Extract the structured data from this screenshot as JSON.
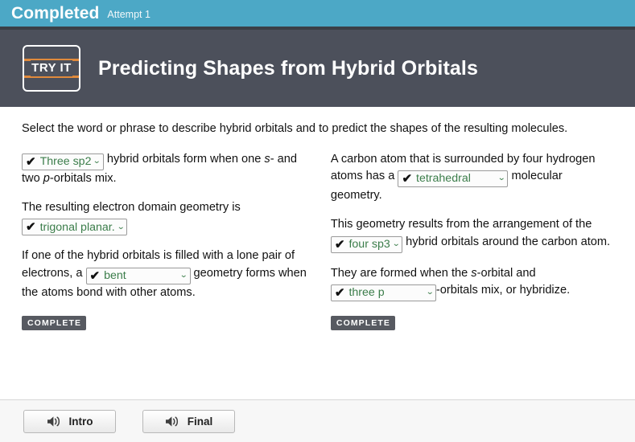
{
  "status_bar": {
    "state_label": "Completed",
    "attempt_label": "Attempt 1",
    "background_color": "#4ca8c6"
  },
  "header": {
    "logo_text": "TRY IT",
    "title": "Predicting Shapes from Hybrid Orbitals",
    "background_color": "#4c505b",
    "logo_accent_color": "#e08a3c"
  },
  "main": {
    "instructions": "Select the word or phrase to describe hybrid orbitals and to predict the shapes of the resulting molecules.",
    "answer_color": "#3b7d4a",
    "left_column": {
      "blocks": [
        {
          "id": "three-sp2",
          "select": {
            "name": "hybrid-orbital-count-select",
            "value": "Three sp2",
            "checkmark": "✔",
            "caret": "⌄"
          },
          "text_before": "",
          "text_after_parts": [
            " hybrid orbitals form when one ",
            "s",
            "- and two ",
            "p",
            "-orbitals mix."
          ]
        },
        {
          "id": "trigonal-planar",
          "lead_text": "The resulting electron domain geometry is",
          "select": {
            "name": "electron-domain-geometry-select",
            "value": "trigonal planar.",
            "checkmark": "✔",
            "caret": "⌄"
          }
        },
        {
          "id": "bent",
          "text_before": "If one of the hybrid orbitals is filled with a lone pair of electrons, a ",
          "select": {
            "name": "lone-pair-geometry-select",
            "value": "bent",
            "checkmark": "✔",
            "caret": "⌄"
          },
          "text_after": " geometry forms when the atoms bond with other atoms."
        }
      ],
      "complete_badge": "COMPLETE"
    },
    "right_column": {
      "blocks": [
        {
          "id": "tetrahedral",
          "text_before": "A carbon atom that is surrounded by four hydrogen atoms has a ",
          "select": {
            "name": "molecular-geometry-select",
            "value": "tetrahedral",
            "checkmark": "✔",
            "caret": "⌄"
          },
          "text_after": " molecular geometry."
        },
        {
          "id": "four-sp3",
          "text_before": "This geometry results from the arrangement of the ",
          "select": {
            "name": "sp3-orbital-count-select",
            "value": "four sp3",
            "checkmark": "✔",
            "caret": "⌄"
          },
          "text_after": " hybrid orbitals around the carbon atom."
        },
        {
          "id": "three-p",
          "text_before_parts": [
            "They are formed when the ",
            "s",
            "-orbital and"
          ],
          "select": {
            "name": "p-orbital-count-select",
            "value": "three p",
            "checkmark": "✔",
            "caret": "⌄"
          },
          "text_after": "-orbitals mix, or hybridize."
        }
      ],
      "complete_badge": "COMPLETE"
    }
  },
  "footer": {
    "buttons": [
      {
        "name": "intro-audio-button",
        "label": "Intro",
        "icon": "speaker-icon"
      },
      {
        "name": "final-audio-button",
        "label": "Final",
        "icon": "speaker-icon"
      }
    ]
  }
}
